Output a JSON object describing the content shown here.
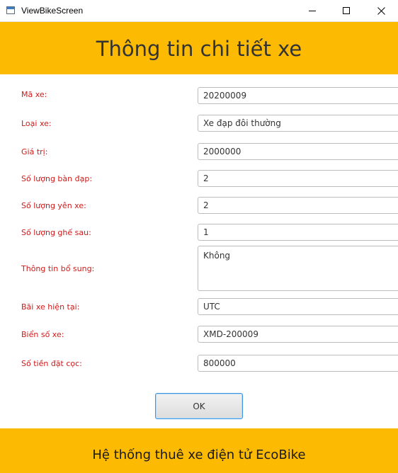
{
  "window": {
    "title": "ViewBikeScreen"
  },
  "header": {
    "title": "Thông tin chi tiết xe"
  },
  "form": {
    "fields": [
      {
        "label": "Mã xe:",
        "value": "20200009"
      },
      {
        "label": "Loại xe:",
        "value": "Xe đạp đôi thường"
      },
      {
        "label": "Giá trị:",
        "value": "2000000"
      },
      {
        "label": "Số lượng bàn đạp:",
        "value": "2"
      },
      {
        "label": "Số lượng yên xe:",
        "value": "2"
      },
      {
        "label": "Số lượng ghế sau:",
        "value": "1"
      },
      {
        "label": "Thông tin bổ sung:",
        "value": "Không"
      },
      {
        "label": "Bãi xe hiện tại:",
        "value": "UTC"
      },
      {
        "label": "Biển số xe:",
        "value": "XMD-200009"
      },
      {
        "label": "Số tiền đặt cọc:",
        "value": "800000"
      }
    ]
  },
  "actions": {
    "ok_label": "OK"
  },
  "footer": {
    "text": "Hệ thống thuê xe điện tử EcoBike"
  },
  "colors": {
    "banner": "#fcba03",
    "label": "#d01818"
  },
  "icons": {
    "app": "window-app-icon",
    "minimize": "minimize-icon",
    "maximize": "maximize-icon",
    "close": "close-icon"
  }
}
